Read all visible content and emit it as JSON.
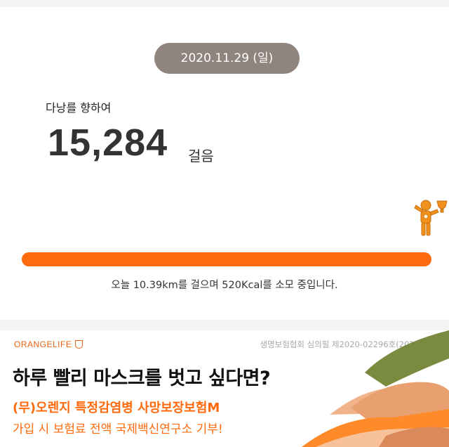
{
  "walk_card": {
    "date": "2020.11.29 (일)",
    "destination_label": "다낭를 향하여",
    "steps": "15,284",
    "steps_unit": "걸음",
    "summary": "오늘 10.39km를 걸으며 520Kcal를 소모 중입니다.",
    "progress_fraction": 1.0,
    "accent_color": "#ff6a0d"
  },
  "ad_banner": {
    "brand": "ORANGELIFE",
    "review_notice": "생명보험협회 심의필 제2020-02296호(2020-07-28)",
    "headline": "하루 빨리 마스크를 벗고 싶다면?",
    "product": "(무)오렌지 특정감염병 사망보장보험M",
    "donation": "가입 시 보험료 전액 국제백신연구소 기부!",
    "brand_color": "#e8620d"
  }
}
